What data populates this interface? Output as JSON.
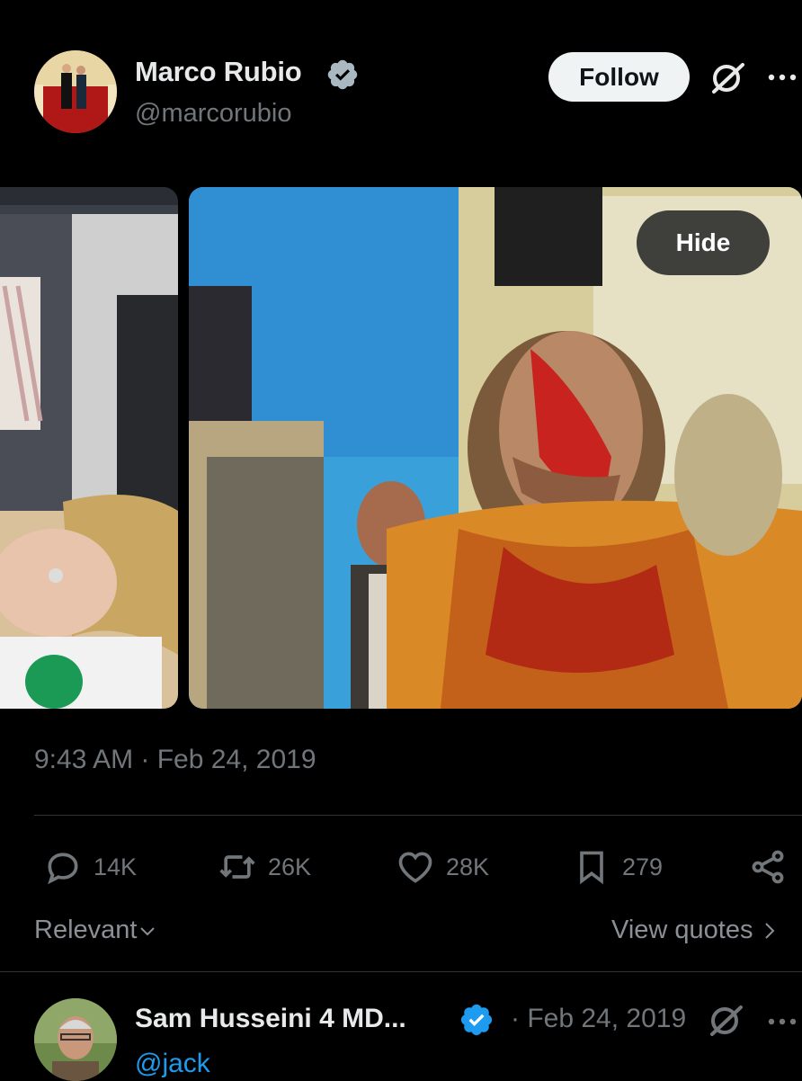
{
  "post": {
    "author_name": "Marco Rubio",
    "author_handle": "@marcorubio",
    "follow_label": "Follow",
    "hide_label": "Hide",
    "timestamp": "9:43 AM · Feb 24, 2019",
    "stats": {
      "replies": "14K",
      "reposts": "26K",
      "likes": "28K",
      "bookmarks": "279"
    },
    "relevant_label": "Relevant",
    "view_quotes_label": "View quotes"
  },
  "reply": {
    "author_name": "Sam Husseini 4 MD...",
    "date": "· Feb 24, 2019",
    "handle": "@jack"
  },
  "colors": {
    "background": "#000000",
    "text_primary": "#e7e9ea",
    "text_secondary": "#71767b",
    "accent": "#1d9bf0",
    "follow_bg": "#eff3f4"
  },
  "icons": [
    "verified-badge-icon",
    "grok-icon",
    "more-icon",
    "reply-icon",
    "repost-icon",
    "like-icon",
    "bookmark-icon",
    "share-icon",
    "chevron-down-icon",
    "chevron-right-icon"
  ]
}
